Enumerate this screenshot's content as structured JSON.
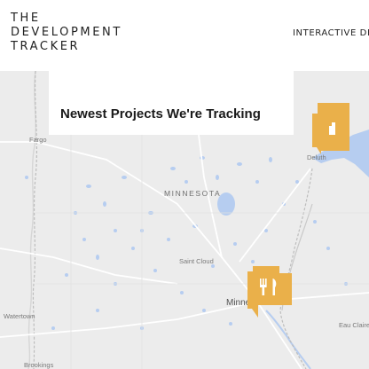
{
  "header": {
    "logo_lines": [
      "THE",
      "DEVELOPMENT",
      "TRACKER"
    ],
    "nav_label": "INTERACTIVE DEV"
  },
  "card": {
    "title": "Newest Projects We're Tracking"
  },
  "map": {
    "labels": {
      "fargo": "Fargo",
      "minnesota": "MINNESOTA",
      "saint_cloud": "Saint Cloud",
      "duluth": "Deluth",
      "minneapolis": "Minne",
      "watertown": "Watertown",
      "eau_claire": "Eau Claire",
      "brookings": "Brookings"
    },
    "markers": [
      {
        "name": "project-marker-duluth",
        "icon": "building-icon"
      },
      {
        "name": "project-marker-minneapolis",
        "icon": "fork-knife-icon"
      }
    ]
  },
  "colors": {
    "map_bg": "#ececec",
    "water": "#b6cdf0",
    "marker": "#eab04a",
    "roads": "#ffffff"
  }
}
